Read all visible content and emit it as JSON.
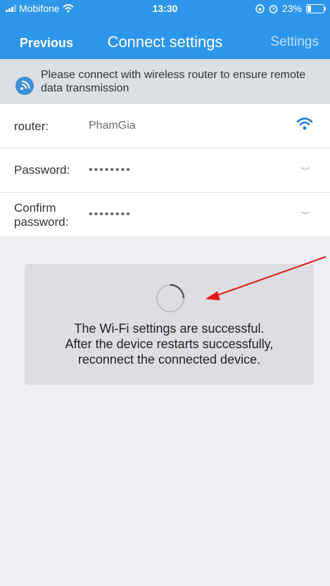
{
  "status_bar": {
    "carrier": "Mobifone",
    "time": "13:30",
    "battery_percent": "23%",
    "battery_level": 0.23,
    "icons": [
      "signal-bars-icon",
      "wifi-status-icon",
      "rotation-lock-icon",
      "alarm-icon",
      "battery-icon"
    ]
  },
  "nav": {
    "back_label": "Previous",
    "title": "Connect settings",
    "settings_label": "Settings"
  },
  "banner": {
    "icon": "wifi-info-icon",
    "text": "Please connect with wireless router to ensure remote data transmission"
  },
  "form": {
    "router": {
      "label": "router:",
      "value": "PhamGia",
      "icon": "wifi-icon"
    },
    "password": {
      "label": "Password:",
      "value": "••••••••",
      "icon": "eye-closed-icon"
    },
    "confirm": {
      "label_line1": "Confirm",
      "label_line2": "password:",
      "value": "••••••••",
      "icon": "eye-closed-icon"
    }
  },
  "loader": {
    "icon": "loading-spinner-icon",
    "line1": "The Wi-Fi settings are successful.",
    "line2": "After the device restarts successfully,",
    "line3": "reconnect the connected device."
  },
  "colors": {
    "header": "#2d96ea",
    "background": "#efeff4",
    "banner": "#dcdfe4",
    "accent": "#1e7fe0",
    "annotation_arrow": "#e0181b"
  }
}
